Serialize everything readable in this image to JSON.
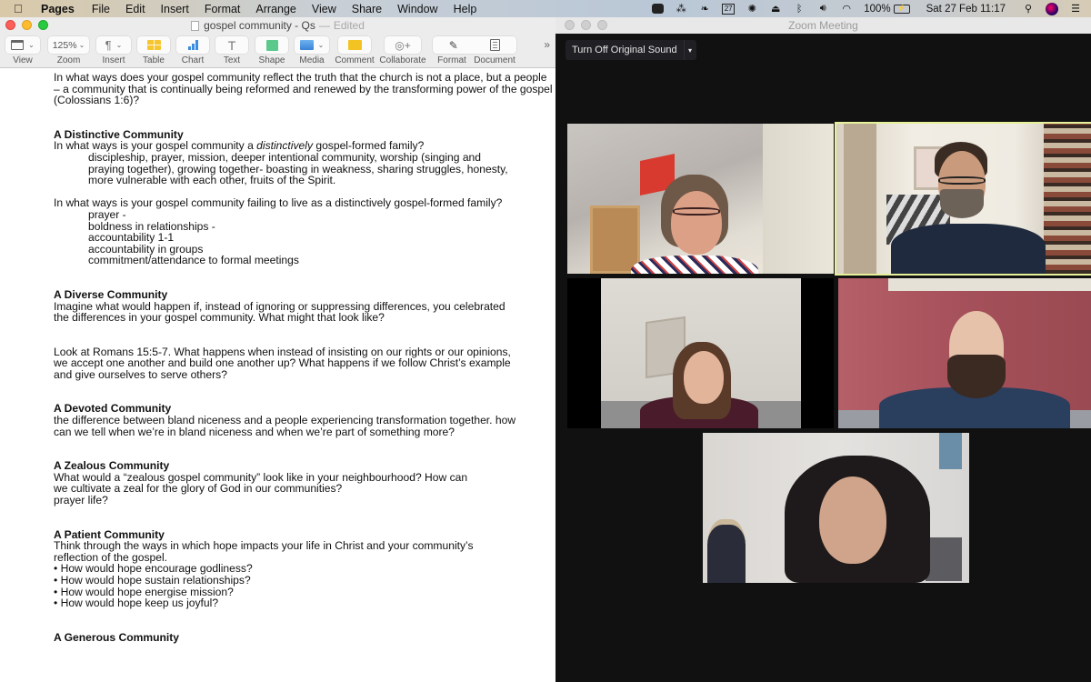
{
  "menubar": {
    "apple_icon": "apple-logo-icon",
    "app_name": "Pages",
    "items": [
      "File",
      "Edit",
      "Insert",
      "Format",
      "Arrange",
      "View",
      "Share",
      "Window",
      "Help"
    ],
    "status": {
      "icons": [
        "zoom-icon",
        "dropbox-sync-icon",
        "evernote-icon",
        "calendar-icon",
        "eye-icon",
        "airplay-icon",
        "bluetooth-icon",
        "volume-icon",
        "wifi-icon"
      ],
      "calendar_day": "27",
      "battery_percent": "100%",
      "datetime": "Sat 27 Feb  11:17",
      "trailing_icons": [
        "spotlight-search-icon",
        "siri-icon",
        "notification-center-icon"
      ]
    }
  },
  "pages": {
    "title": "gospel community - Qs",
    "title_separator": "—",
    "edited": "Edited",
    "toolbar": {
      "zoom_value": "125%",
      "buttons": [
        "View",
        "Zoom",
        "Insert",
        "Table",
        "Chart",
        "Text",
        "Shape",
        "Media",
        "Comment",
        "Collaborate",
        "Format",
        "Document"
      ],
      "text_glyph": "T",
      "insert_glyph": "¶",
      "overflow": "»"
    },
    "document": {
      "intro": "In what ways does your gospel community reflect the truth that the church is not a place, but a people – a community that is continually being reformed and renewed by the transforming power of the gospel (Colossians 1:6)?",
      "sections": [
        {
          "heading": "A Distinctive Community",
          "q1_pre": "In what ways is your gospel community a ",
          "q1_em": "distinctively",
          "q1_post": " gospel-formed family?",
          "q1_answer": "discipleship, prayer, mission, deeper intentional community, worship (singing and praying together), growing together- boasting in weakness, sharing struggles, honesty, more vulnerable with each other, fruits of the Spirit.",
          "q2": "In what ways is your gospel community failing to live as a distinctively gospel-formed family?",
          "q2_answers": [
            "prayer -",
            "boldness in relationships -",
            "accountability 1-1",
            "accountability in groups",
            "commitment/attendance to formal meetings"
          ]
        },
        {
          "heading": "A Diverse Community",
          "p1": "Imagine what would happen if, instead of ignoring or suppressing differences, you celebrated the differences in your gospel community. What might that look like?",
          "p2": "Look at Romans 15:5-7. What happens when instead of insisting on our rights or our opinions, we accept one another and build one another up? What happens if we follow Christ’s example and give ourselves to serve others?"
        },
        {
          "heading": "A Devoted Community",
          "p1": "the difference between bland niceness and a people experiencing transformation together. how can we tell when we’re in bland niceness and when we’re part of something more?"
        },
        {
          "heading": "A Zealous Community",
          "p1": "What would a “zealous gospel community” look like in your neighbourhood? How can we cultivate a zeal for the glory of God in our communities?",
          "p2": "prayer life?"
        },
        {
          "heading": "A Patient Community",
          "p1": "Think through the ways in which hope impacts your life in Christ and your community’s reflection of the gospel.",
          "bullets": [
            "• How would hope encourage godliness?",
            "• How would hope sustain relationships?",
            "• How would hope energise mission?",
            "•  How would hope keep us joyful?"
          ]
        },
        {
          "heading": "A Generous Community"
        }
      ]
    }
  },
  "zoom": {
    "title": "Zoom Meeting",
    "original_sound_button": "Turn Off Original Sound",
    "original_sound_dropdown": "▾",
    "participants": [
      {
        "id": "participant-1",
        "active_speaker": false
      },
      {
        "id": "participant-2",
        "active_speaker": true
      },
      {
        "id": "participant-3",
        "active_speaker": false
      },
      {
        "id": "participant-4",
        "active_speaker": false
      },
      {
        "id": "participant-5",
        "active_speaker": false
      }
    ],
    "colors": {
      "background": "#111111",
      "active_speaker_border": "#e6f19a"
    }
  }
}
